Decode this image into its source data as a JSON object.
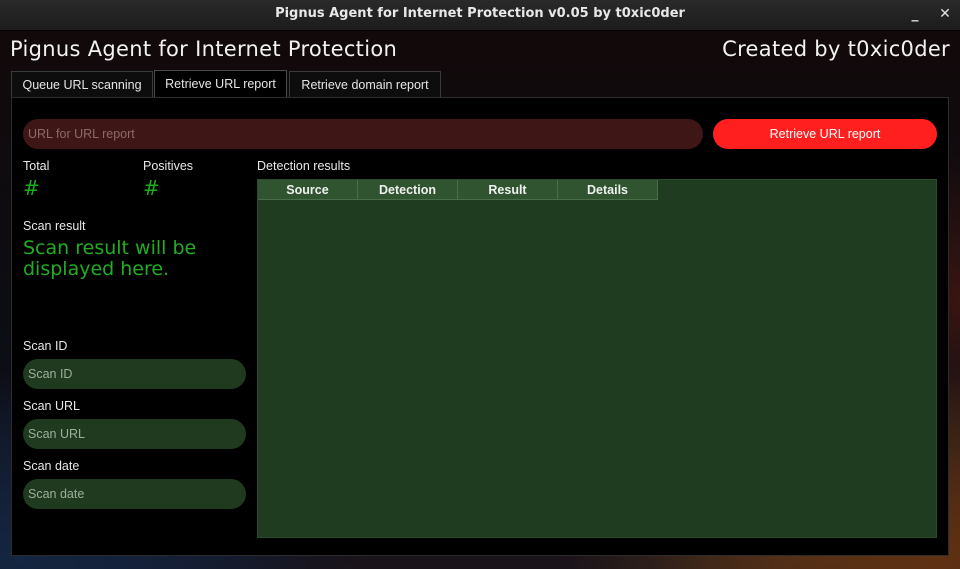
{
  "window": {
    "title": "Pignus Agent for Internet Protection v0.05 by t0xic0der",
    "minimize_glyph": "_",
    "close_glyph": "✕"
  },
  "header": {
    "app_title": "Pignus Agent for Internet Protection",
    "credit": "Created by t0xic0der"
  },
  "tabs": [
    {
      "label": "Queue URL scanning",
      "active": false
    },
    {
      "label": "Retrieve URL report",
      "active": true
    },
    {
      "label": "Retrieve domain report",
      "active": false
    }
  ],
  "form": {
    "url_placeholder": "URL for URL report",
    "retrieve_label": "Retrieve URL report"
  },
  "stats": {
    "total_label": "Total",
    "total_value": "#",
    "positives_label": "Positives",
    "positives_value": "#"
  },
  "scan": {
    "result_label": "Scan result",
    "result_message": "Scan result will be displayed here.",
    "id_label": "Scan ID",
    "id_placeholder": "Scan ID",
    "url_label": "Scan URL",
    "url_placeholder": "Scan URL",
    "date_label": "Scan date",
    "date_placeholder": "Scan date"
  },
  "detection": {
    "label": "Detection results",
    "columns": [
      "Source",
      "Detection",
      "Result",
      "Details"
    ]
  },
  "colors": {
    "accent_red": "#ff1f1f",
    "accent_green": "#1fae1f",
    "field_green": "#1f3a1f",
    "table_green": "#203c20"
  }
}
